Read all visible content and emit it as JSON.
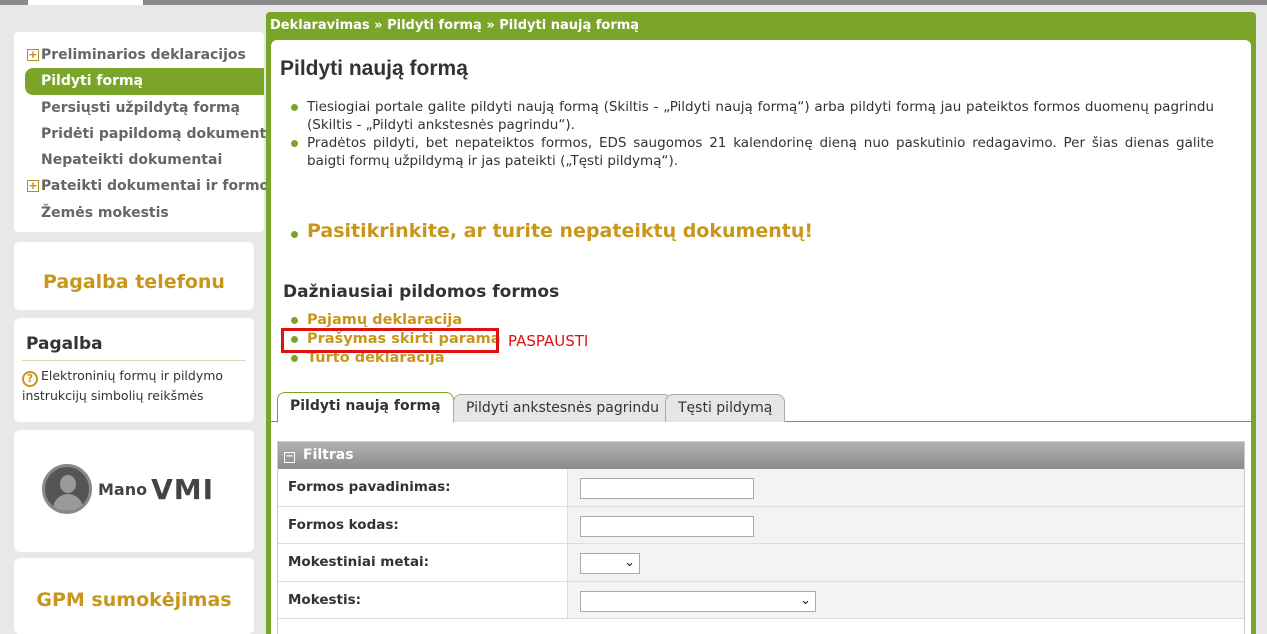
{
  "sidebar": {
    "items": [
      {
        "label": "Preliminarios deklaracijos",
        "expandable": true
      },
      {
        "label": "Pildyti formą",
        "active": true
      },
      {
        "label": "Persiųsti užpildytą formą"
      },
      {
        "label": "Pridėti papildomą dokumentą"
      },
      {
        "label": "Nepateikti dokumentai"
      },
      {
        "label": "Pateikti dokumentai ir formos",
        "expandable": true
      },
      {
        "label": "Žemės mokestis"
      }
    ],
    "plus_glyph": "+",
    "phone_help": "Pagalba telefonu",
    "help": {
      "title": "Pagalba",
      "icon": "?",
      "text": "Elektroninių formų ir pildymo instrukcijų simbolių reikšmės"
    },
    "mano_vmi": {
      "part1": "Mano",
      "part2": "VMI"
    },
    "gpm": "GPM sumokėjimas"
  },
  "breadcrumb": "Deklaravimas » Pildyti formą » Pildyti naują formą",
  "main": {
    "title": "Pildyti naują formą",
    "info": [
      "Tiesiogiai portale galite pildyti naują formą (Skiltis - „Pildyti naują formą“) arba pildyti formą jau pateiktos formos duomenų pagrindu (Skiltis - „Pildyti ankstesnės pagrindu“).",
      "Pradėtos pildyti, bet nepateiktos formos, EDS saugomos 21 kalendorinę dieną nuo paskutinio redagavimo. Per šias dienas galite baigti formų užpildymą ir jas pateikti („Tęsti pildymą“)."
    ],
    "warning": "Pasitikrinkite, ar turite nepateiktų dokumentų!",
    "frequent_title": "Dažniausiai pildomos formos",
    "frequent_links": [
      "Pajamų deklaracija",
      "Prašymas skirti paramą",
      "Turto deklaracija"
    ],
    "annotation": "PASPAUSTI",
    "tabs": [
      "Pildyti naują formą",
      "Pildyti ankstesnės pagrindu",
      "Tęsti pildymą"
    ],
    "filter": {
      "title": "Filtras",
      "toggle_glyph": "−",
      "fields": [
        {
          "label": "Formos pavadinimas:",
          "type": "input",
          "value": ""
        },
        {
          "label": "Formos kodas:",
          "type": "input",
          "value": ""
        },
        {
          "label": "Mokestiniai metai:",
          "type": "select",
          "value": ""
        },
        {
          "label": "Mokestis:",
          "type": "select",
          "value": ""
        }
      ]
    }
  },
  "colors": {
    "accent_green": "#7ba528",
    "gold": "#c8961a",
    "annotation_red": "#e01010"
  },
  "icons": {
    "dropdown": "⌄"
  }
}
